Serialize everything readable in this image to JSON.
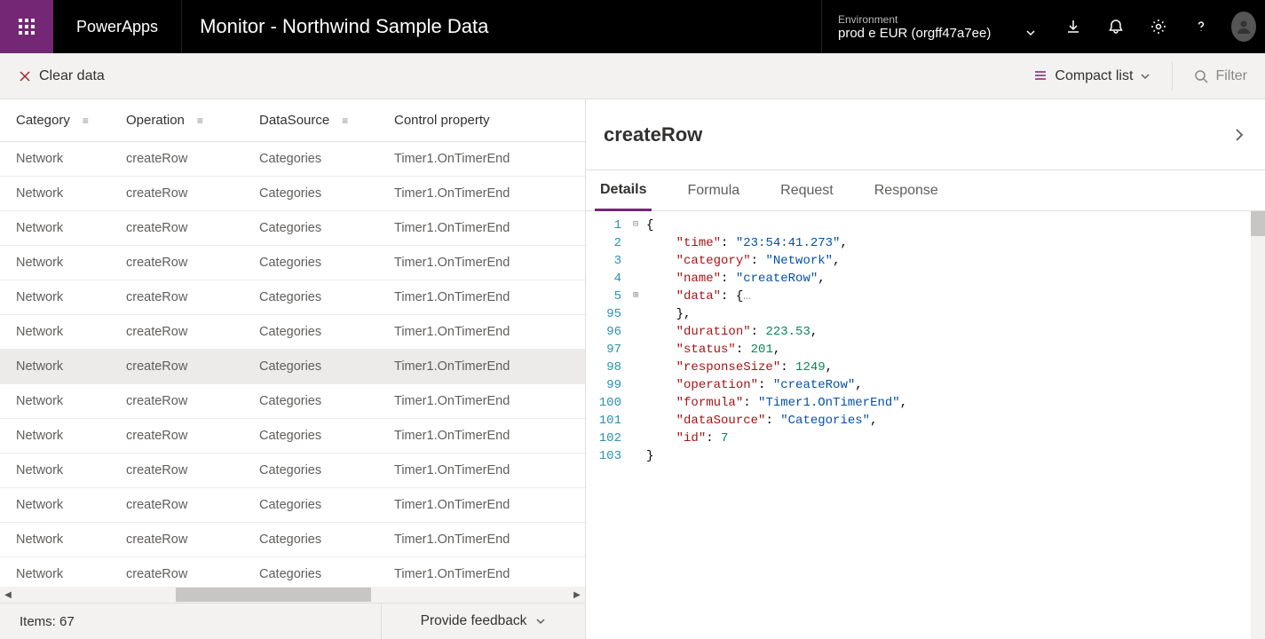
{
  "header": {
    "brand": "PowerApps",
    "pageTitle": "Monitor - Northwind Sample Data",
    "envLabel": "Environment",
    "envName": "prod e EUR (orgff47a7ee)"
  },
  "toolbar": {
    "clear": "Clear data",
    "compact": "Compact list",
    "filter": "Filter"
  },
  "grid": {
    "columns": {
      "category": "Category",
      "operation": "Operation",
      "dataSource": "DataSource",
      "controlProperty": "Control property"
    },
    "rows": [
      {
        "cat": "Network",
        "op": "createRow",
        "ds": "Categories",
        "cp": "Timer1.OnTimerEnd"
      },
      {
        "cat": "Network",
        "op": "createRow",
        "ds": "Categories",
        "cp": "Timer1.OnTimerEnd"
      },
      {
        "cat": "Network",
        "op": "createRow",
        "ds": "Categories",
        "cp": "Timer1.OnTimerEnd"
      },
      {
        "cat": "Network",
        "op": "createRow",
        "ds": "Categories",
        "cp": "Timer1.OnTimerEnd"
      },
      {
        "cat": "Network",
        "op": "createRow",
        "ds": "Categories",
        "cp": "Timer1.OnTimerEnd"
      },
      {
        "cat": "Network",
        "op": "createRow",
        "ds": "Categories",
        "cp": "Timer1.OnTimerEnd"
      },
      {
        "cat": "Network",
        "op": "createRow",
        "ds": "Categories",
        "cp": "Timer1.OnTimerEnd",
        "selected": true
      },
      {
        "cat": "Network",
        "op": "createRow",
        "ds": "Categories",
        "cp": "Timer1.OnTimerEnd"
      },
      {
        "cat": "Network",
        "op": "createRow",
        "ds": "Categories",
        "cp": "Timer1.OnTimerEnd"
      },
      {
        "cat": "Network",
        "op": "createRow",
        "ds": "Categories",
        "cp": "Timer1.OnTimerEnd"
      },
      {
        "cat": "Network",
        "op": "createRow",
        "ds": "Categories",
        "cp": "Timer1.OnTimerEnd"
      },
      {
        "cat": "Network",
        "op": "createRow",
        "ds": "Categories",
        "cp": "Timer1.OnTimerEnd"
      },
      {
        "cat": "Network",
        "op": "createRow",
        "ds": "Categories",
        "cp": "Timer1.OnTimerEnd"
      }
    ]
  },
  "status": {
    "items": "Items: 67",
    "feedback": "Provide feedback"
  },
  "detail": {
    "title": "createRow",
    "tabs": {
      "details": "Details",
      "formula": "Formula",
      "request": "Request",
      "response": "Response"
    },
    "json": {
      "time": "23:54:41.273",
      "category": "Network",
      "name": "createRow",
      "data_collapsed": true,
      "duration": 223.53,
      "status": 201,
      "responseSize": 1249,
      "operation": "createRow",
      "formula": "Timer1.OnTimerEnd",
      "dataSource": "Categories",
      "id": 7
    },
    "lines": [
      "1",
      "2",
      "3",
      "4",
      "5",
      "95",
      "96",
      "97",
      "98",
      "99",
      "100",
      "101",
      "102",
      "103"
    ]
  }
}
